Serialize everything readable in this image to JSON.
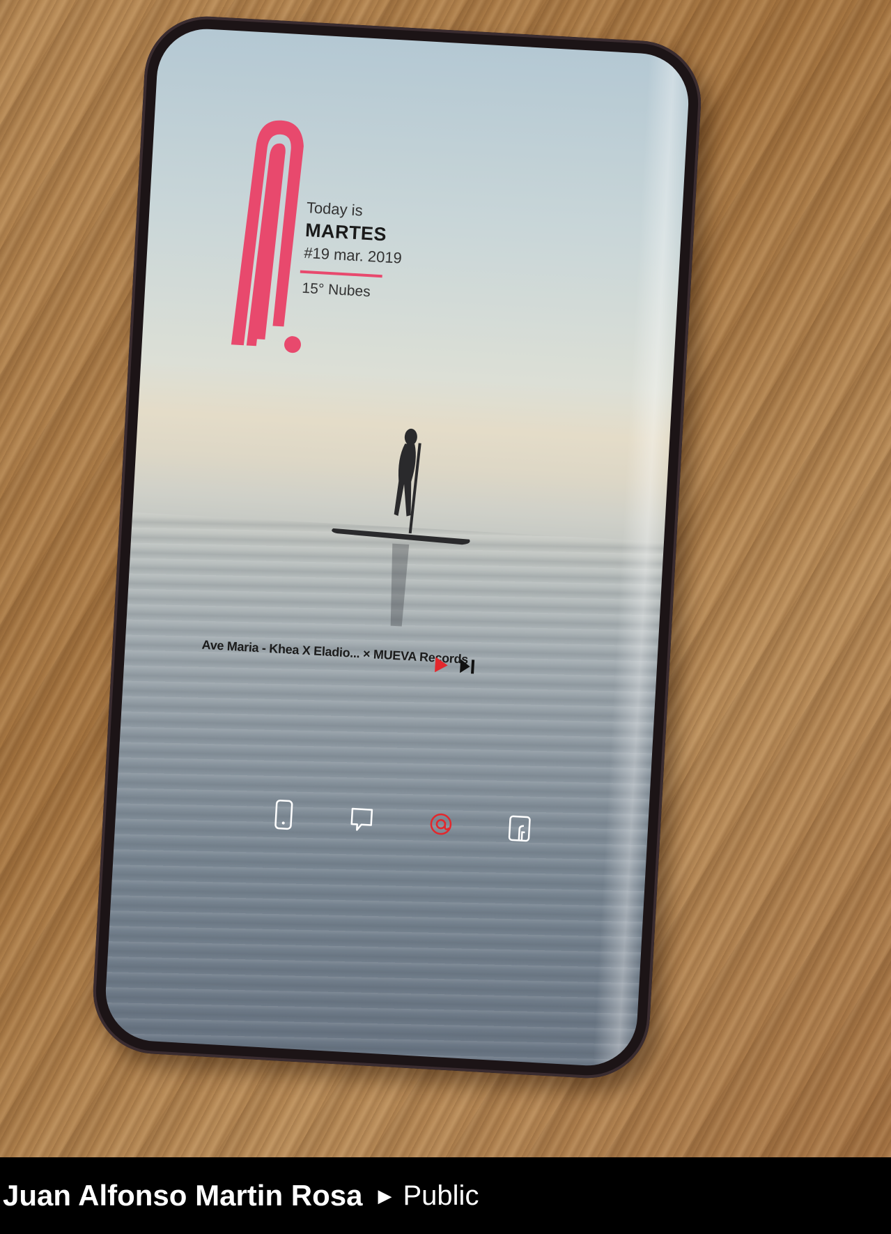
{
  "screen": {
    "widget": {
      "today_label": "Today is",
      "day_name": "MARTES",
      "date": "#19 mar. 2019",
      "weather": "15° Nubes",
      "accent_color": "#e8496d"
    },
    "music": {
      "track": "Ave Maria - Khea X Eladio... × MUEVA Records",
      "play_icon": "play-icon",
      "next_icon": "skip-next-icon"
    },
    "dock": [
      {
        "name": "phone-icon"
      },
      {
        "name": "messages-icon"
      },
      {
        "name": "at-sign-icon",
        "color": "#e3272c"
      },
      {
        "name": "facebook-icon"
      }
    ]
  },
  "post": {
    "author": "Juan Alfonso Martin Rosa",
    "visibility": "Public"
  }
}
